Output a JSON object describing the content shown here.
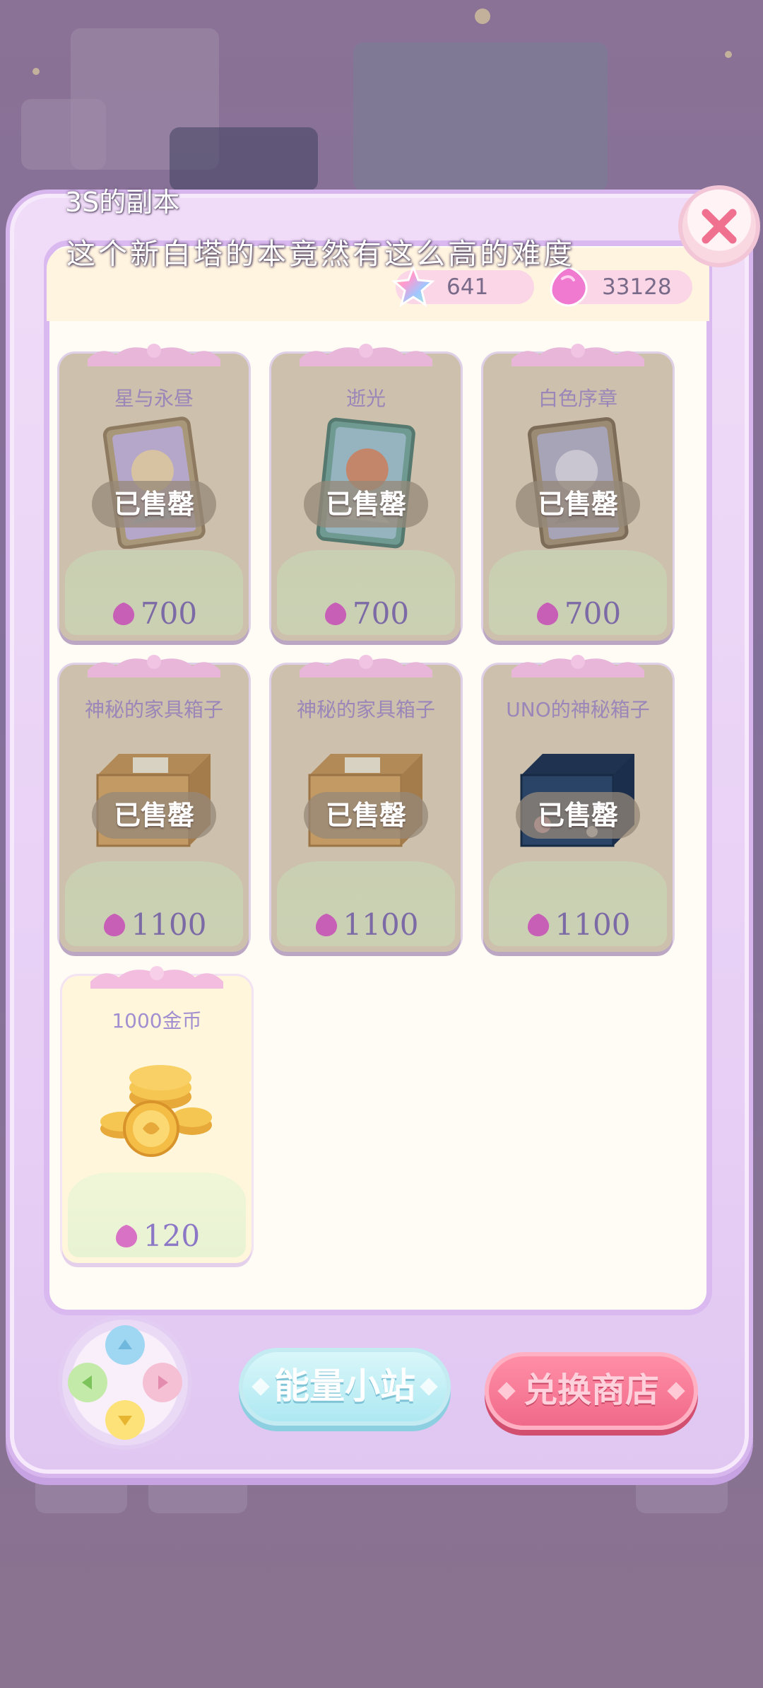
{
  "notification": {
    "sender": "3S的副本",
    "message": "这个新白塔的本竟然有这么高的难度"
  },
  "currencies": {
    "stars": {
      "icon": "rainbow-star-icon",
      "value": "641"
    },
    "gems": {
      "icon": "pink-gem-icon",
      "value": "33128"
    }
  },
  "items": [
    {
      "title": "星与永昼",
      "price": "700",
      "sold": true,
      "sold_label": "已售罄",
      "image": "card-art-star"
    },
    {
      "title": "逝光",
      "price": "700",
      "sold": true,
      "sold_label": "已售罄",
      "image": "card-art-light"
    },
    {
      "title": "白色序章",
      "price": "700",
      "sold": true,
      "sold_label": "已售罄",
      "image": "card-art-white"
    },
    {
      "title": "神秘的家具箱子",
      "price": "1100",
      "sold": true,
      "sold_label": "已售罄",
      "image": "cardboard-box"
    },
    {
      "title": "神秘的家具箱子",
      "price": "1100",
      "sold": true,
      "sold_label": "已售罄",
      "image": "cardboard-box"
    },
    {
      "title": "UNO的神秘箱子",
      "price": "1100",
      "sold": true,
      "sold_label": "已售罄",
      "image": "navy-box"
    },
    {
      "title": "1000金币",
      "price": "120",
      "sold": false,
      "image": "gold-coins"
    }
  ],
  "buttons": {
    "energy_station": "能量小站",
    "exchange_shop": "兑换商店"
  },
  "colors": {
    "panel_border": "#d9b9ef",
    "sold_card": "#cdc0ac",
    "available_card": "#fff6dc",
    "price_text": "#7c6aa6",
    "shop_button": "#f06a8a",
    "energy_button": "#aee8f2"
  }
}
